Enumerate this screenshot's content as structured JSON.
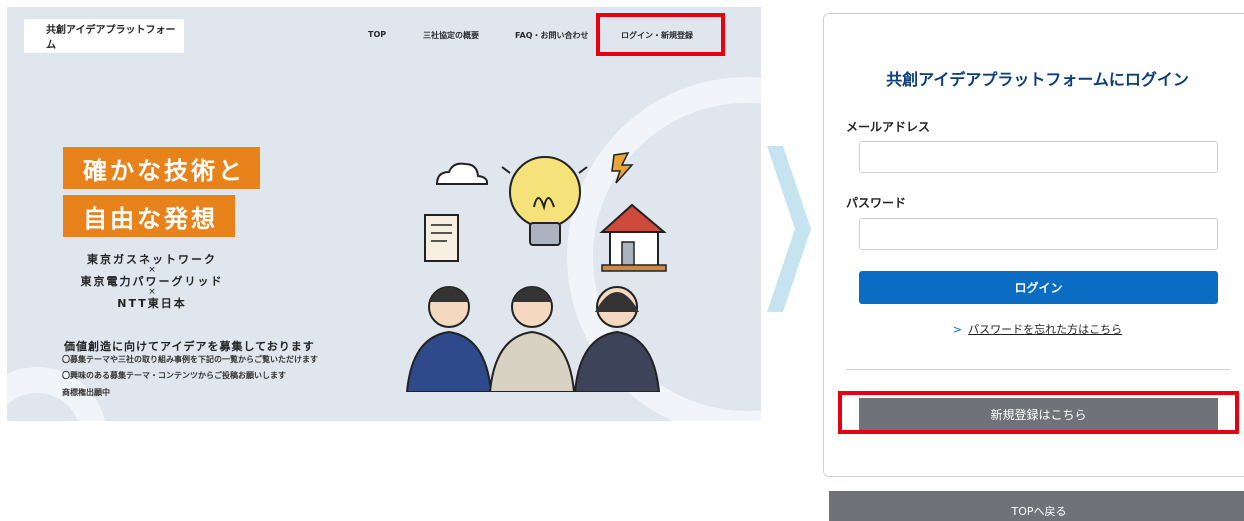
{
  "site": {
    "logo": "共創アイデアプラットフォーム",
    "nav": {
      "top": "TOP",
      "overview": "三社協定の概要",
      "faq": "FAQ・お問い合わせ",
      "login_register": "ログイン・新規登録"
    },
    "hero": {
      "line1": "確かな技術と",
      "line2": "自由な発想"
    },
    "partners": {
      "p1": "東京ガスネットワーク",
      "p2": "東京電力パワーグリッド",
      "p3": "NTT東日本",
      "separator": "×"
    },
    "description": {
      "title": "価値創造に向けてアイデアを募集しております",
      "line1": "〇募集テーマや三社の取り組み事例を下記の一覧からご覧いただけます",
      "line2": "〇興味のある募集テーマ・コンテンツからご投稿お願いします",
      "line3": "商標権出願中"
    }
  },
  "login": {
    "title": "共創アイデアプラットフォームにログイン",
    "email_label": "メールアドレス",
    "email_value": "",
    "password_label": "パスワード",
    "password_value": "",
    "login_button": "ログイン",
    "forgot_chevron": ">",
    "forgot_link": "パスワードを忘れた方はこちら",
    "register_button": "新規登録はこちら",
    "back_button": "TOPへ戻る"
  },
  "colors": {
    "accent_orange": "#e8821a",
    "primary_blue": "#0a6cc2",
    "title_navy": "#0a3d7a",
    "highlight_red": "#e60012",
    "gray_button": "#6f7378"
  }
}
